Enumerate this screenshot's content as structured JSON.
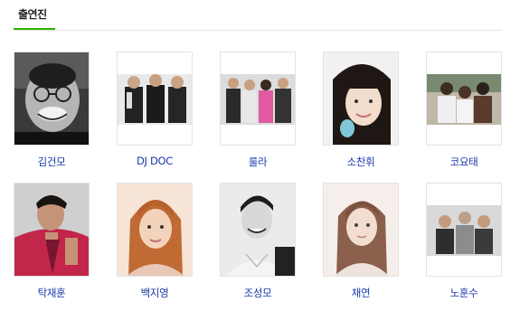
{
  "section": {
    "tab_label": "출연진",
    "accent_color": "#2db400",
    "link_color": "#1a3aa8"
  },
  "cast": [
    {
      "name": "김건모"
    },
    {
      "name": "DJ DOC"
    },
    {
      "name": "룰라"
    },
    {
      "name": "소찬휘"
    },
    {
      "name": "코요태"
    },
    {
      "name": "탁재훈"
    },
    {
      "name": "백지영"
    },
    {
      "name": "조성모"
    },
    {
      "name": "채연"
    },
    {
      "name": "노훈수"
    }
  ]
}
